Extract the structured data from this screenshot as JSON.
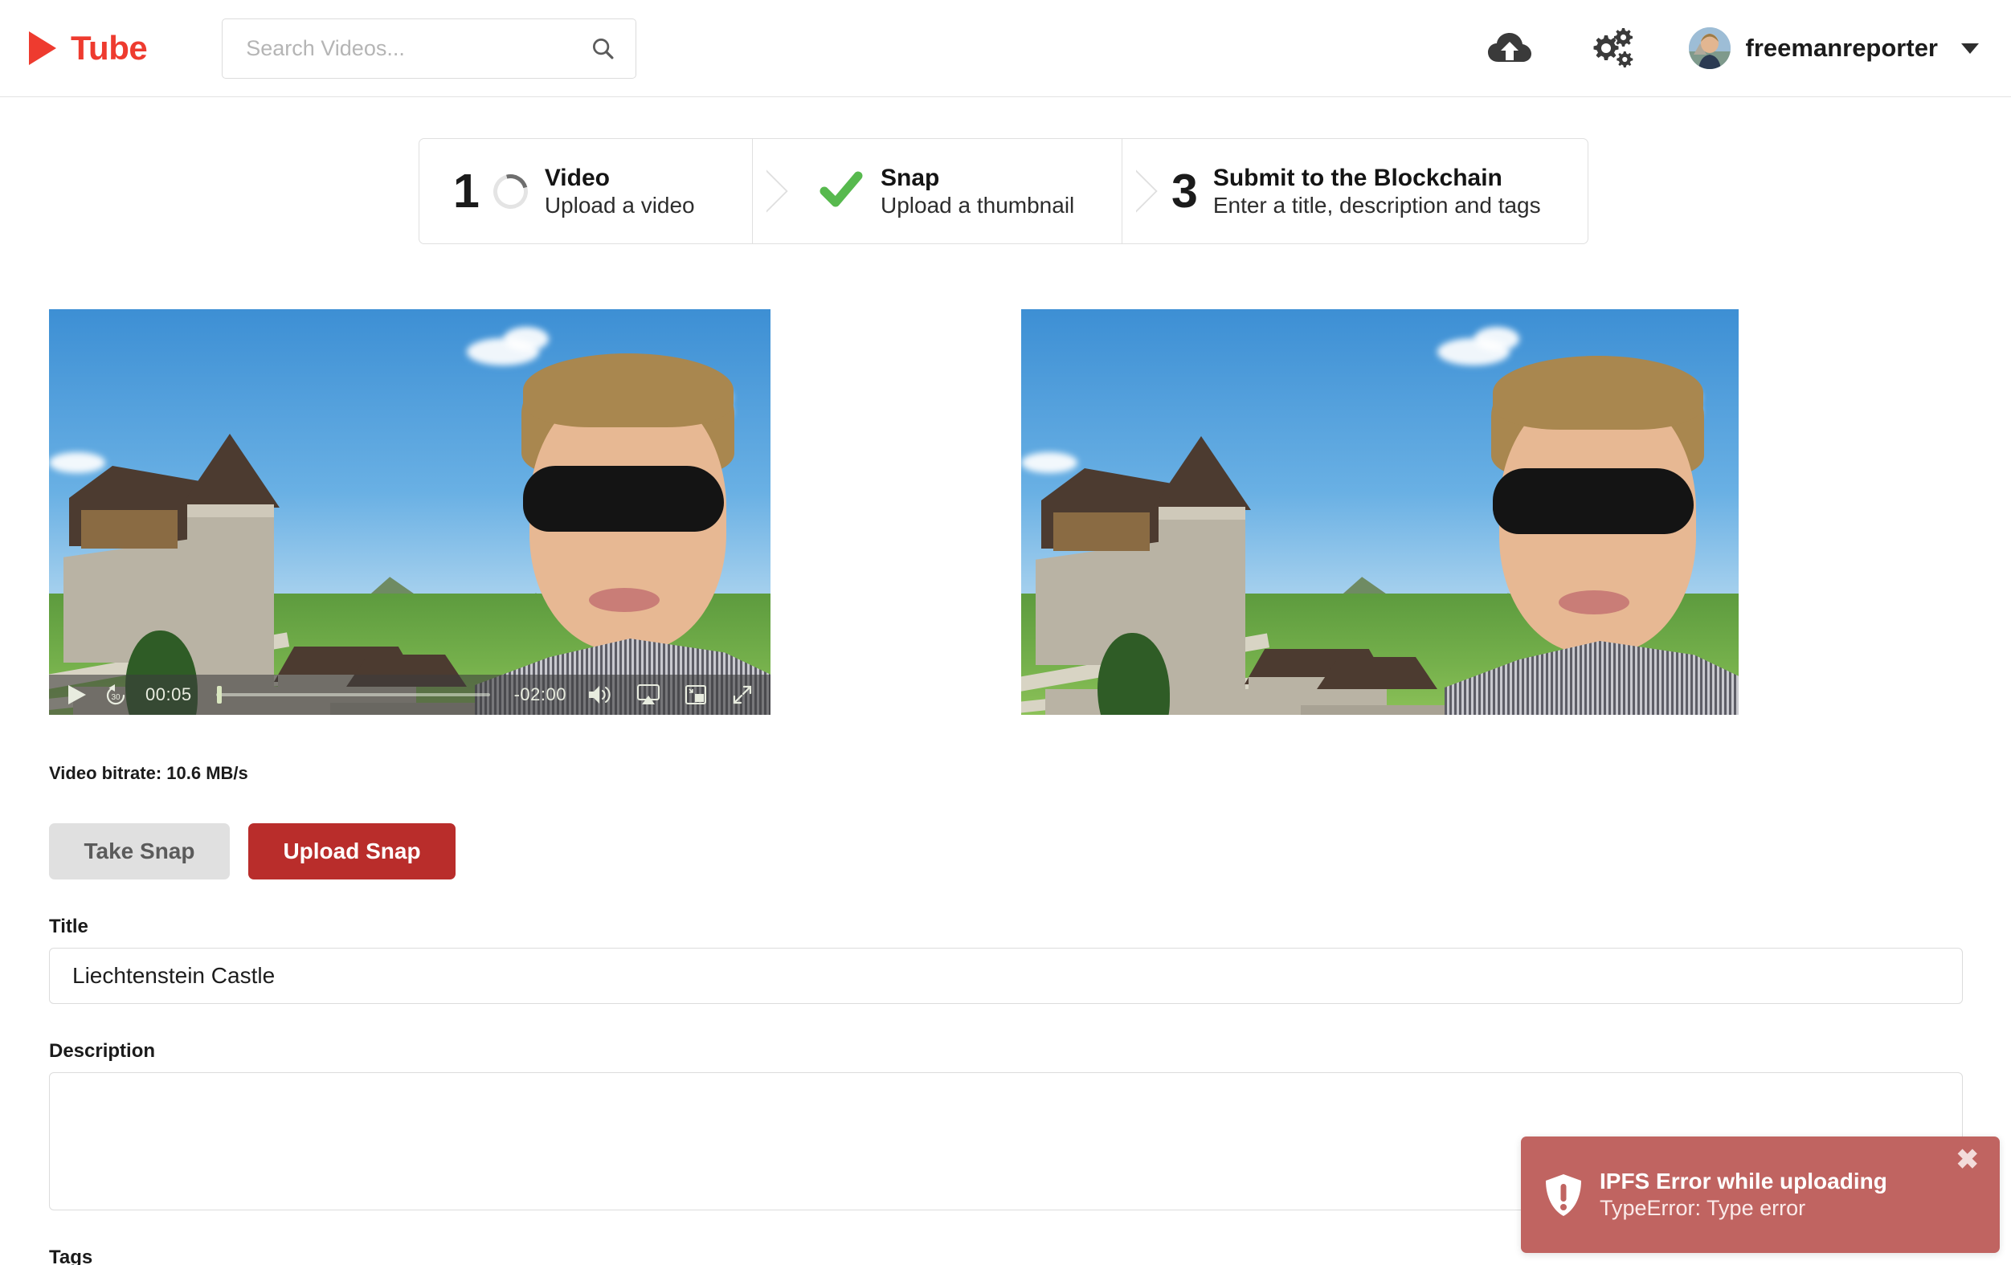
{
  "header": {
    "brand": {
      "name": "Tube",
      "logo_icon": "play-triangle-icon",
      "color": "#ee3b2f"
    },
    "search": {
      "value": "",
      "placeholder": "Search Videos...",
      "icon": "search-icon"
    },
    "upload_icon": "cloud-upload-icon",
    "settings_icon": "gears-icon",
    "avatar_icon": "user-avatar",
    "username": "freemanreporter",
    "caret_icon": "chevron-down-icon"
  },
  "stepper": {
    "steps": [
      {
        "number": "1",
        "marker": "loading-spinner",
        "title": "Video",
        "subtitle": "Upload a video"
      },
      {
        "number": "",
        "marker": "green-check",
        "title": "Snap",
        "subtitle": "Upload a thumbnail"
      },
      {
        "number": "3",
        "marker": "none",
        "title": "Submit to the Blockchain",
        "subtitle": "Enter a title, description and tags"
      }
    ],
    "check_color": "#57b94e"
  },
  "player": {
    "play_icon": "play-icon",
    "skip_back_icon": "rewind-30-icon",
    "current_time": "00:05",
    "remaining_time": "-02:00",
    "volume_icon": "volume-up-icon",
    "airplay_icon": "airplay-icon",
    "pip_icon": "picture-in-picture-icon",
    "fullscreen_icon": "fullscreen-icon",
    "progress_percent": 2
  },
  "media": {
    "video_alt": "Vaduz Castle selfie video frame",
    "snap_alt": "Vaduz Castle selfie thumbnail"
  },
  "stats": {
    "bitrate": "Video bitrate: 10.6 MB/s"
  },
  "actions": {
    "take_snap": "Take Snap",
    "upload_snap": "Upload Snap",
    "take_snap_color": "#e0e0e0",
    "upload_snap_color": "#b92d2b"
  },
  "form": {
    "title_label": "Title",
    "title_value": "Liechtenstein Castle",
    "title_placeholder": "",
    "description_label": "Description",
    "description_value": "",
    "description_placeholder": "",
    "tags_label": "Tags"
  },
  "toast": {
    "icon": "shield-warning-icon",
    "title": "IPFS Error while uploading",
    "message": "TypeError: Type error",
    "close_label": "✖",
    "background": "#c06461"
  }
}
